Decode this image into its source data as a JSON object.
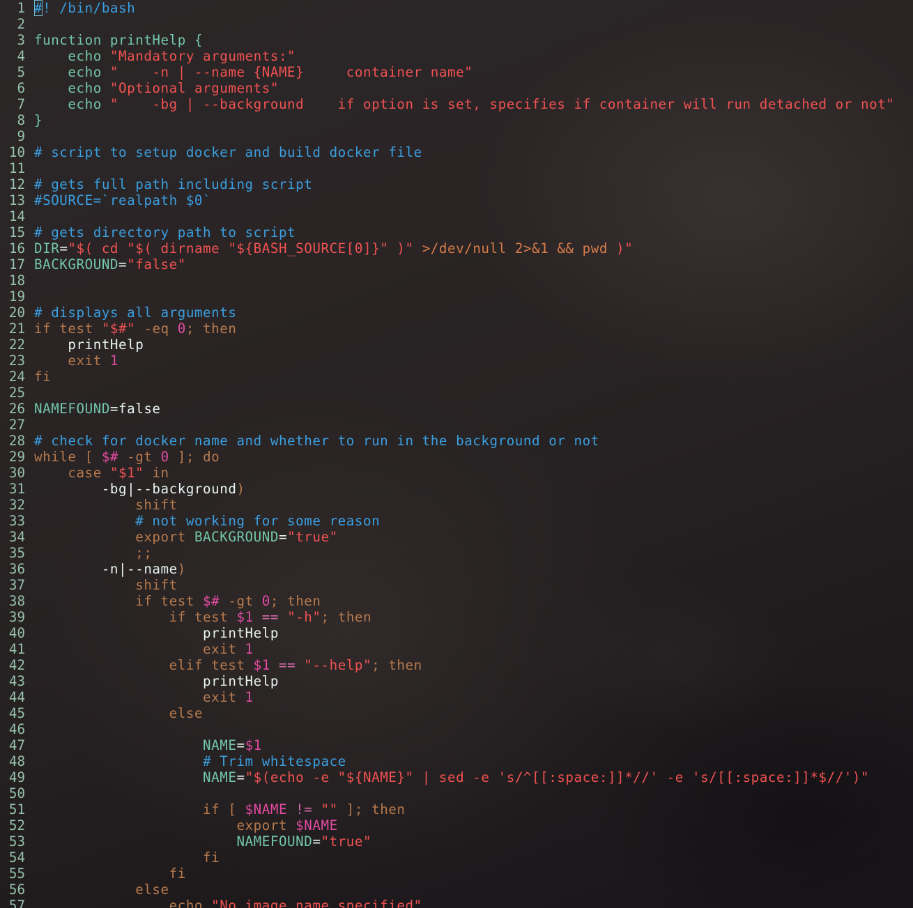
{
  "colors": {
    "background": "#201c1e",
    "line_number": "#98c1ab",
    "comment": "#3a9fe0",
    "string": "#f05252",
    "keyword": "#b77a4d",
    "identifier": "#73c7aa",
    "function_name": "#e8f4ef",
    "number": "#e04ba0",
    "variable": "#e04ba0",
    "operator": "#cf6aa7",
    "punctuation": "#b7b7b7",
    "redirect": "#d87c4a",
    "cursor": "#6fb7d6"
  },
  "editor": {
    "cursor_line": 1,
    "lines": [
      {
        "n": "1",
        "tokens": [
          {
            "t": "#",
            "c": "comment",
            "cursor": true
          },
          {
            "t": "! /bin/bash",
            "c": "comment"
          }
        ]
      },
      {
        "n": "2",
        "tokens": []
      },
      {
        "n": "3",
        "tokens": [
          {
            "t": "function printHelp {",
            "c": "identifier"
          }
        ]
      },
      {
        "n": "4",
        "tokens": [
          {
            "t": "    echo ",
            "c": "identifier"
          },
          {
            "t": "\"Mandatory arguments:\"",
            "c": "string"
          }
        ]
      },
      {
        "n": "5",
        "tokens": [
          {
            "t": "    echo ",
            "c": "identifier"
          },
          {
            "t": "\"    -n | --name {NAME}     container name\"",
            "c": "string"
          }
        ]
      },
      {
        "n": "6",
        "tokens": [
          {
            "t": "    echo ",
            "c": "identifier"
          },
          {
            "t": "\"Optional arguments\"",
            "c": "string"
          }
        ]
      },
      {
        "n": "7",
        "tokens": [
          {
            "t": "    echo ",
            "c": "identifier"
          },
          {
            "t": "\"    -bg | --background    if option is set, specifies if container will run detached or not\"",
            "c": "string"
          }
        ]
      },
      {
        "n": "8",
        "tokens": [
          {
            "t": "}",
            "c": "identifier"
          }
        ]
      },
      {
        "n": "9",
        "tokens": []
      },
      {
        "n": "10",
        "tokens": [
          {
            "t": "# script to setup docker and build docker file",
            "c": "comment"
          }
        ]
      },
      {
        "n": "11",
        "tokens": []
      },
      {
        "n": "12",
        "tokens": [
          {
            "t": "# gets full path including script",
            "c": "comment"
          }
        ]
      },
      {
        "n": "13",
        "tokens": [
          {
            "t": "#SOURCE=`realpath $0`",
            "c": "comment"
          }
        ]
      },
      {
        "n": "14",
        "tokens": []
      },
      {
        "n": "15",
        "tokens": [
          {
            "t": "# gets directory path to script",
            "c": "comment"
          }
        ]
      },
      {
        "n": "16",
        "tokens": [
          {
            "t": "DIR",
            "c": "identifier"
          },
          {
            "t": "=",
            "c": "function_name"
          },
          {
            "t": "\"$( cd \"$( dirname \"${BASH_SOURCE[0]}\" )\" ",
            "c": "string"
          },
          {
            "t": ">/dev/null 2>&1 && pwd ",
            "c": "redirect"
          },
          {
            "t": ")\"",
            "c": "string"
          }
        ]
      },
      {
        "n": "17",
        "tokens": [
          {
            "t": "BACKGROUND",
            "c": "identifier"
          },
          {
            "t": "=",
            "c": "function_name"
          },
          {
            "t": "\"false\"",
            "c": "string"
          }
        ]
      },
      {
        "n": "18",
        "tokens": []
      },
      {
        "n": "19",
        "tokens": []
      },
      {
        "n": "20",
        "tokens": [
          {
            "t": "# displays all arguments",
            "c": "comment"
          }
        ]
      },
      {
        "n": "21",
        "tokens": [
          {
            "t": "if test ",
            "c": "keyword"
          },
          {
            "t": "\"$#\"",
            "c": "string"
          },
          {
            "t": " -eq ",
            "c": "keyword"
          },
          {
            "t": "0",
            "c": "number"
          },
          {
            "t": "; then",
            "c": "keyword"
          }
        ]
      },
      {
        "n": "22",
        "tokens": [
          {
            "t": "    printHelp",
            "c": "function_name"
          }
        ]
      },
      {
        "n": "23",
        "tokens": [
          {
            "t": "    exit ",
            "c": "keyword"
          },
          {
            "t": "1",
            "c": "number"
          }
        ]
      },
      {
        "n": "24",
        "tokens": [
          {
            "t": "fi",
            "c": "keyword"
          }
        ]
      },
      {
        "n": "25",
        "tokens": []
      },
      {
        "n": "26",
        "tokens": [
          {
            "t": "NAMEFOUND",
            "c": "identifier"
          },
          {
            "t": "=false",
            "c": "function_name"
          }
        ]
      },
      {
        "n": "27",
        "tokens": []
      },
      {
        "n": "28",
        "tokens": [
          {
            "t": "# check for docker name and whether to run in the background or not",
            "c": "comment"
          }
        ]
      },
      {
        "n": "29",
        "tokens": [
          {
            "t": "while [ ",
            "c": "keyword"
          },
          {
            "t": "$#",
            "c": "variable"
          },
          {
            "t": " -gt ",
            "c": "keyword"
          },
          {
            "t": "0",
            "c": "number"
          },
          {
            "t": " ]; do",
            "c": "keyword"
          }
        ]
      },
      {
        "n": "30",
        "tokens": [
          {
            "t": "    case ",
            "c": "keyword"
          },
          {
            "t": "\"$1\"",
            "c": "string"
          },
          {
            "t": " in",
            "c": "keyword"
          }
        ]
      },
      {
        "n": "31",
        "tokens": [
          {
            "t": "        -bg|--background",
            "c": "function_name"
          },
          {
            "t": ")",
            "c": "keyword"
          }
        ]
      },
      {
        "n": "32",
        "tokens": [
          {
            "t": "            shift",
            "c": "keyword"
          }
        ]
      },
      {
        "n": "33",
        "tokens": [
          {
            "t": "            # not working for some reason",
            "c": "comment"
          }
        ]
      },
      {
        "n": "34",
        "tokens": [
          {
            "t": "            export ",
            "c": "keyword"
          },
          {
            "t": "BACKGROUND",
            "c": "identifier"
          },
          {
            "t": "=",
            "c": "function_name"
          },
          {
            "t": "\"true\"",
            "c": "string"
          }
        ]
      },
      {
        "n": "35",
        "tokens": [
          {
            "t": "            ;;",
            "c": "keyword"
          }
        ]
      },
      {
        "n": "36",
        "tokens": [
          {
            "t": "        -n|--name",
            "c": "function_name"
          },
          {
            "t": ")",
            "c": "keyword"
          }
        ]
      },
      {
        "n": "37",
        "tokens": [
          {
            "t": "            shift",
            "c": "keyword"
          }
        ]
      },
      {
        "n": "38",
        "tokens": [
          {
            "t": "            if test ",
            "c": "keyword"
          },
          {
            "t": "$#",
            "c": "variable"
          },
          {
            "t": " -gt ",
            "c": "keyword"
          },
          {
            "t": "0",
            "c": "number"
          },
          {
            "t": "; then",
            "c": "keyword"
          }
        ]
      },
      {
        "n": "39",
        "tokens": [
          {
            "t": "                if test ",
            "c": "keyword"
          },
          {
            "t": "$1",
            "c": "variable"
          },
          {
            "t": " == ",
            "c": "operator"
          },
          {
            "t": "\"-h\"",
            "c": "string"
          },
          {
            "t": "; then",
            "c": "keyword"
          }
        ]
      },
      {
        "n": "40",
        "tokens": [
          {
            "t": "                    printHelp",
            "c": "function_name"
          }
        ]
      },
      {
        "n": "41",
        "tokens": [
          {
            "t": "                    exit ",
            "c": "keyword"
          },
          {
            "t": "1",
            "c": "number"
          }
        ]
      },
      {
        "n": "42",
        "tokens": [
          {
            "t": "                elif test ",
            "c": "keyword"
          },
          {
            "t": "$1",
            "c": "variable"
          },
          {
            "t": " == ",
            "c": "operator"
          },
          {
            "t": "\"--help\"",
            "c": "string"
          },
          {
            "t": "; then",
            "c": "keyword"
          }
        ]
      },
      {
        "n": "43",
        "tokens": [
          {
            "t": "                    printHelp",
            "c": "function_name"
          }
        ]
      },
      {
        "n": "44",
        "tokens": [
          {
            "t": "                    exit ",
            "c": "keyword"
          },
          {
            "t": "1",
            "c": "number"
          }
        ]
      },
      {
        "n": "45",
        "tokens": [
          {
            "t": "                else",
            "c": "keyword"
          }
        ]
      },
      {
        "n": "46",
        "tokens": []
      },
      {
        "n": "47",
        "tokens": [
          {
            "t": "                    NAME",
            "c": "identifier"
          },
          {
            "t": "=",
            "c": "function_name"
          },
          {
            "t": "$1",
            "c": "variable"
          }
        ]
      },
      {
        "n": "48",
        "tokens": [
          {
            "t": "                    # Trim whitespace",
            "c": "comment"
          }
        ]
      },
      {
        "n": "49",
        "tokens": [
          {
            "t": "                    NAME",
            "c": "identifier"
          },
          {
            "t": "=",
            "c": "function_name"
          },
          {
            "t": "\"$(echo -e \"${NAME}\" | sed -e 's/^[[:space:]]*//' -e 's/[[:space:]]*$//')\"",
            "c": "string"
          }
        ]
      },
      {
        "n": "50",
        "tokens": []
      },
      {
        "n": "51",
        "tokens": [
          {
            "t": "                    if [ ",
            "c": "keyword"
          },
          {
            "t": "$NAME",
            "c": "variable"
          },
          {
            "t": " != ",
            "c": "operator"
          },
          {
            "t": "\"\"",
            "c": "string"
          },
          {
            "t": " ]; then",
            "c": "keyword"
          }
        ]
      },
      {
        "n": "52",
        "tokens": [
          {
            "t": "                        export ",
            "c": "keyword"
          },
          {
            "t": "$NAME",
            "c": "variable"
          }
        ]
      },
      {
        "n": "53",
        "tokens": [
          {
            "t": "                        NAMEFOUND",
            "c": "identifier"
          },
          {
            "t": "=",
            "c": "function_name"
          },
          {
            "t": "\"true\"",
            "c": "string"
          }
        ]
      },
      {
        "n": "54",
        "tokens": [
          {
            "t": "                    fi",
            "c": "keyword"
          }
        ]
      },
      {
        "n": "55",
        "tokens": [
          {
            "t": "                fi",
            "c": "keyword"
          }
        ]
      },
      {
        "n": "56",
        "tokens": [
          {
            "t": "            else",
            "c": "keyword"
          }
        ]
      },
      {
        "n": "57",
        "tokens": [
          {
            "t": "                echo ",
            "c": "keyword"
          },
          {
            "t": "\"No image name specified\"",
            "c": "string"
          }
        ]
      }
    ]
  }
}
